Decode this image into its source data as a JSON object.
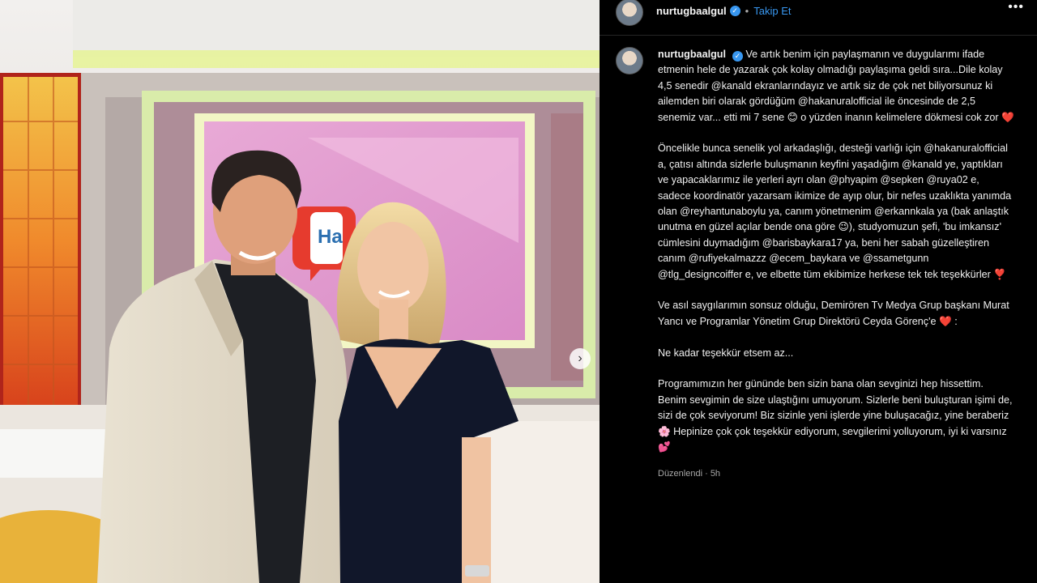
{
  "post": {
    "username": "nurtugbaalgul",
    "follow_label": "Takip Et",
    "separator": "•",
    "more_icon": "more-horizontal-icon",
    "carousel_next_icon": "chevron-right-icon",
    "carousel_next_glyph": "›",
    "verified_glyph": "✓",
    "more_glyph": "•••",
    "photo_overlay_text": "Ha"
  },
  "caption": {
    "p1": "Ve artık benim için paylaşmanın ve duygularımı ifade etmenin hele de yazarak çok kolay olmadığı paylaşıma geldi sıra...Dile kolay 4,5 senedir @kanald ekranlarındayız ve artık siz de çok net biliyorsunuz ki ailemden biri olarak gördüğüm @hakanuralofficial ile öncesinde de 2,5 senemiz var... etti mi 7 sene 😊 o yüzden inanın kelimelere dökmesi cok zor ❤️",
    "p2": "Öncelikle bunca senelik yol arkadaşlığı, desteği varlığı için @hakanuralofficial a, çatısı altında sizlerle buluşmanın keyfini yaşadığım @kanald ye, yaptıkları ve yapacaklarımız ile yerleri ayrı olan @phyapim @sepken @ruya02 e, sadece koordinatör yazarsam ikimize de ayıp olur, bir nefes uzaklıkta yanımda olan @reyhantunaboylu ya, canım yönetmenim @erkannkala ya (bak anlaştık unutma en güzel açılar bende ona göre 😉), studyomuzun şefi, 'bu imkansız' cümlesini duymadığım @barisbaykara17 ya, beni her sabah güzelleştiren canım @rufiyekalmazzz @ecem_baykara ve @ssametgunn @tlg_designcoiffer e, ve elbette tüm ekibimize herkese tek tek teşekkürler ❣️",
    "p3": "Ve asıl saygılarımın sonsuz olduğu, Demirören Tv Medya Grup başkanı Murat Yancı ve Programlar Yönetim Grup Direktörü Ceyda Görenç'e ❤️ :",
    "p4": "Ne kadar teşekkür etsem az...",
    "p5": "Programımızın her gününde ben sizin bana olan sevginizi hep hissettim. Benim sevgimin de size ulaştığını umuyorum. Sizlerle beni buluşturan işimi de, sizi de çok seviyorum! Biz sizinle yeni işlerde yine buluşacağız, yine beraberiz 🌸 Hepinize çok çok teşekkür ediyorum, sevgilerimi yolluyorum, iyi ki varsınız 💕",
    "meta": "Düzenlendi · 5h"
  }
}
